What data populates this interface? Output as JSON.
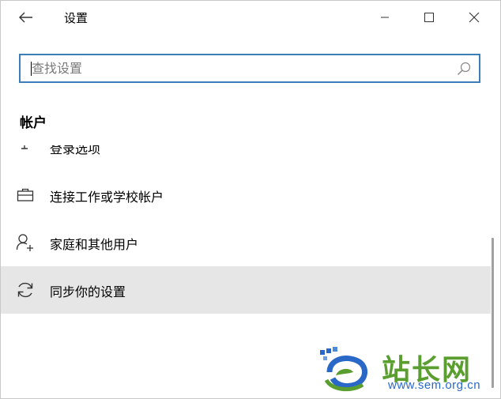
{
  "window": {
    "title": "设置",
    "back_icon": "arrow-left-icon",
    "minimize_icon": "minimize-icon",
    "maximize_icon": "maximize-icon",
    "close_icon": "close-icon"
  },
  "search": {
    "placeholder": "查找设置",
    "value": "",
    "icon": "search-icon",
    "border_color": "#3c7fb8"
  },
  "section": {
    "title": "帐户"
  },
  "list": {
    "items": [
      {
        "label": "登录选项",
        "icon": "key-icon",
        "active": false,
        "partial": true
      },
      {
        "label": "连接工作或学校帐户",
        "icon": "briefcase-icon",
        "active": false
      },
      {
        "label": "家庭和其他用户",
        "icon": "add-person-icon",
        "active": false
      },
      {
        "label": "同步你的设置",
        "icon": "sync-icon",
        "active": true
      }
    ],
    "active_background": "#e6e6e6"
  },
  "watermark": {
    "title": "站长网",
    "url": "www.sem.org.cn"
  }
}
